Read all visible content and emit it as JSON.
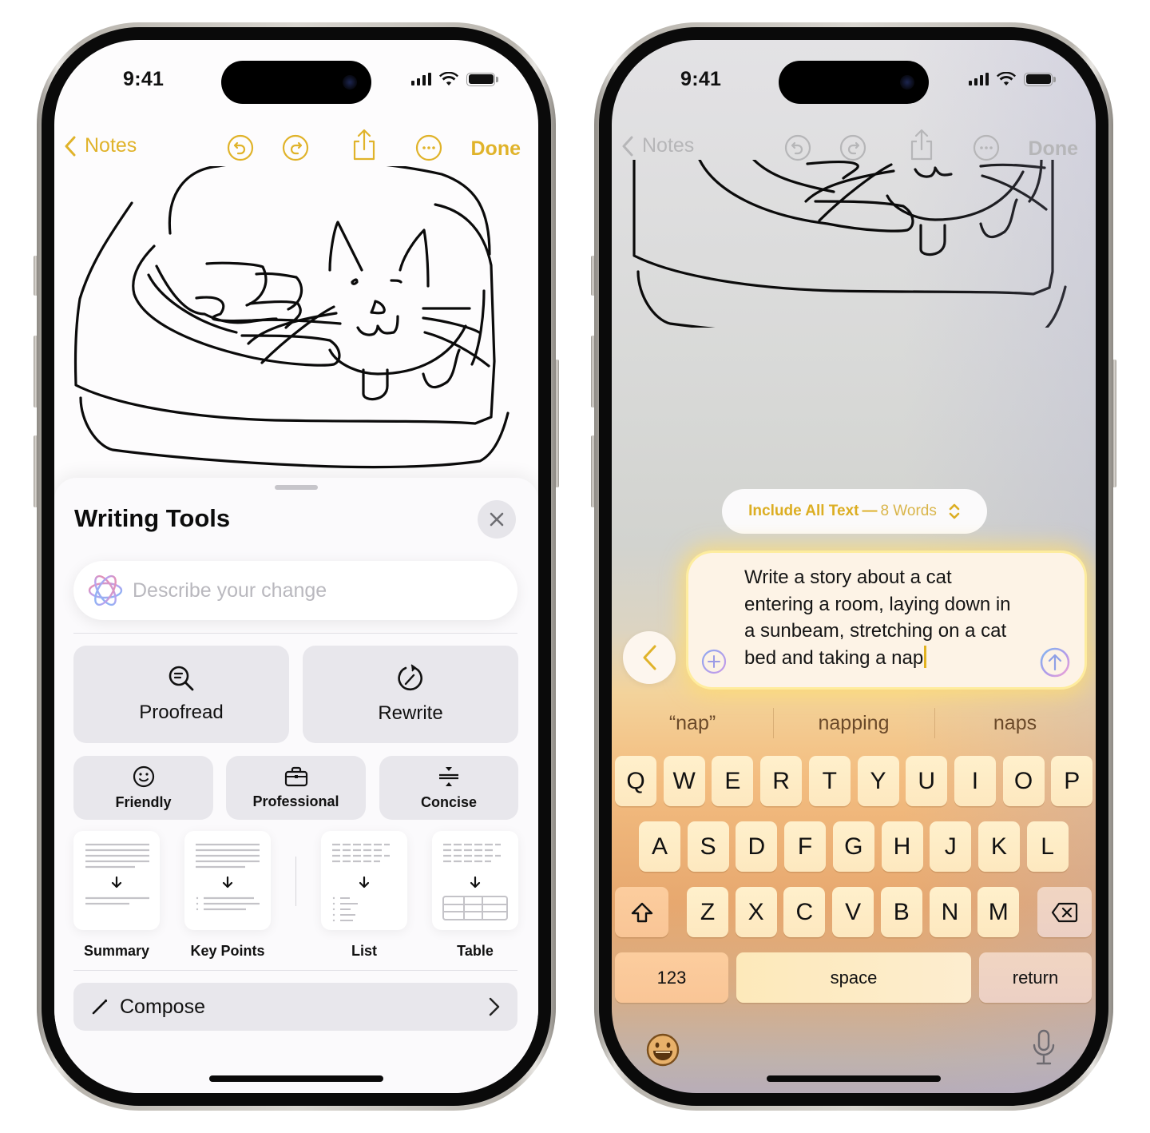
{
  "left_phone": {
    "status_bar": {
      "time": "9:41"
    },
    "nav": {
      "back_label": "Notes",
      "done_label": "Done",
      "icons": [
        "undo-icon",
        "redo-icon",
        "share-icon",
        "more-icon"
      ]
    },
    "writing_tools": {
      "title": "Writing Tools",
      "close_icon": "close-icon",
      "describe_placeholder": "Describe your change",
      "primary_actions": [
        {
          "label": "Proofread",
          "icon": "proofread-magnifier-icon"
        },
        {
          "label": "Rewrite",
          "icon": "rewrite-icon"
        }
      ],
      "tone_actions": [
        {
          "label": "Friendly",
          "icon": "smiley-icon"
        },
        {
          "label": "Professional",
          "icon": "briefcase-icon"
        },
        {
          "label": "Concise",
          "icon": "concise-icon"
        }
      ],
      "format_actions": [
        {
          "label": "Summary",
          "icon": "summary-icon"
        },
        {
          "label": "Key Points",
          "icon": "key-points-icon"
        },
        {
          "label": "List",
          "icon": "list-icon"
        },
        {
          "label": "Table",
          "icon": "table-icon"
        }
      ],
      "compose": {
        "label": "Compose",
        "icon": "pencil-icon"
      }
    }
  },
  "right_phone": {
    "status_bar": {
      "time": "9:41"
    },
    "nav": {
      "back_label": "Notes",
      "done_label": "Done"
    },
    "include_selector": {
      "label": "Include All Text",
      "separator": "—",
      "count": "8 Words"
    },
    "prompt": {
      "text": "Write a story about a cat entering a room, laying down in a sunbeam, stretching on a cat bed and taking a nap",
      "lines": [
        "Write a story about a cat",
        "entering a room, laying down in",
        "a sunbeam, stretching on a cat",
        "bed and taking a nap"
      ]
    },
    "suggestions": [
      "“nap”",
      "napping",
      "naps"
    ],
    "keyboard": {
      "row1": [
        "Q",
        "W",
        "E",
        "R",
        "T",
        "Y",
        "U",
        "I",
        "O",
        "P"
      ],
      "row2": [
        "A",
        "S",
        "D",
        "F",
        "G",
        "H",
        "J",
        "K",
        "L"
      ],
      "row3": [
        "Z",
        "X",
        "C",
        "V",
        "B",
        "N",
        "M"
      ],
      "numbers_label": "123",
      "space_label": "space",
      "return_label": "return"
    }
  },
  "colors": {
    "accent": "#e0b32a",
    "sheet_button": "#e8e7ec",
    "key": "#fdebc4"
  }
}
